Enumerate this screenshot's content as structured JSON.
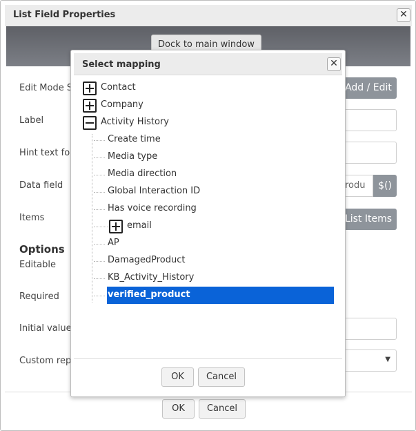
{
  "outer_dialog": {
    "title": "List Field Properties",
    "dock_button": "Dock to main window",
    "fields": {
      "edit_mode_style": "Edit Mode St",
      "label": "Label",
      "hint_text": "Hint text for",
      "data_field": "Data field",
      "items": "Items",
      "editable": "Editable",
      "required": "Required",
      "initial_value": "Initial value",
      "custom_report": "Custom repo"
    },
    "options_heading": "Options",
    "add_edit_button": "Add / Edit",
    "data_field_value": "rodu",
    "dollar_button": "$()",
    "list_items_button": "List Items",
    "ok": "OK",
    "cancel": "Cancel"
  },
  "modal": {
    "title": "Select mapping",
    "tree": {
      "contact": "Contact",
      "company": "Company",
      "activity_history": "Activity History",
      "children": {
        "create_time": "Create time",
        "media_type": "Media type",
        "media_direction": "Media direction",
        "global_interaction_id": "Global Interaction ID",
        "has_voice_recording": "Has voice recording",
        "email": "email",
        "ap": "AP",
        "damaged_product": "DamagedProduct",
        "kb_activity_history": "KB_Activity_History",
        "verified_product": "verified_product"
      }
    },
    "ok": "OK",
    "cancel": "Cancel"
  },
  "colors": {
    "selection": "#0a63d8",
    "accent_button": "#8e949b",
    "dock_band": "#6b6e74"
  }
}
